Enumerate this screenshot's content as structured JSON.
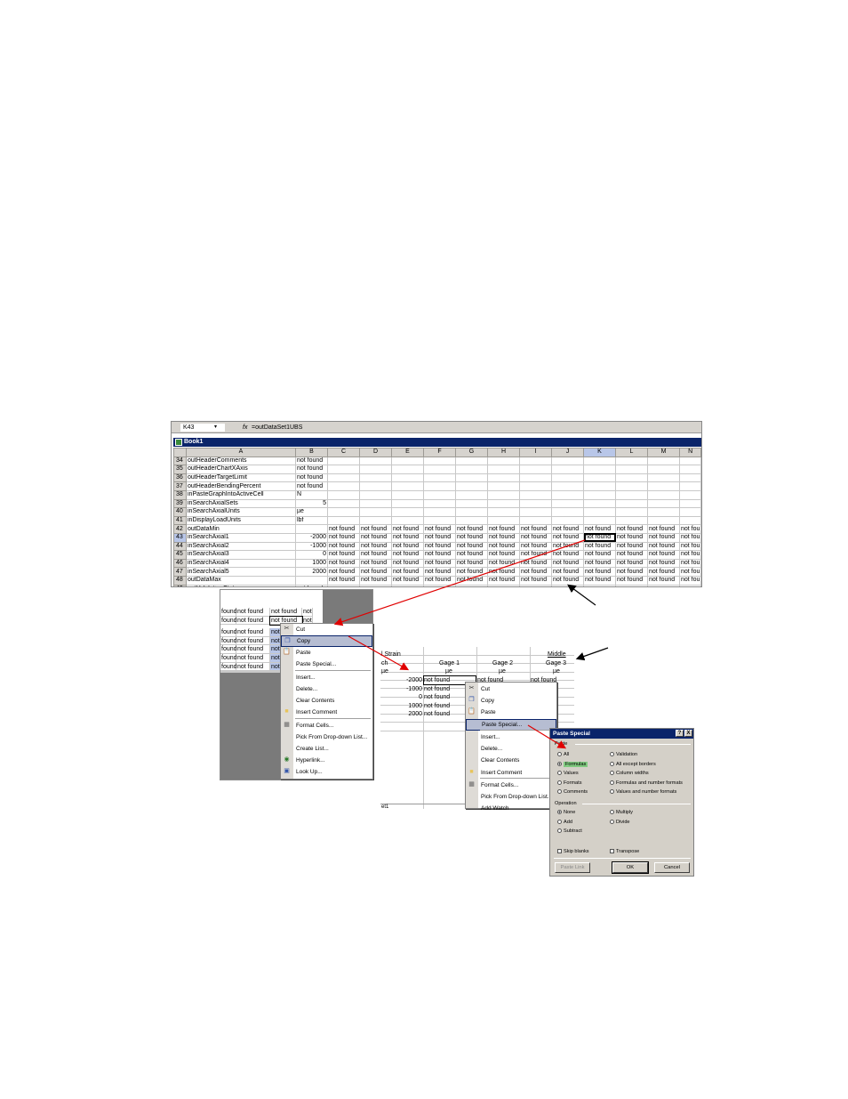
{
  "formula_bar": {
    "name_box": "K43",
    "fx": "fx",
    "formula": "=outDataSet1UBS"
  },
  "workbook_title": "Book1",
  "sheet": {
    "columns": [
      "A",
      "B",
      "C",
      "D",
      "E",
      "F",
      "G",
      "H",
      "I",
      "J",
      "K",
      "L",
      "M",
      "N"
    ],
    "rows": [
      {
        "num": "34",
        "a": "outHeaderComments",
        "b": "not found",
        "rest": []
      },
      {
        "num": "35",
        "a": "outHeaderChartXAxis",
        "b": "not found",
        "rest": []
      },
      {
        "num": "36",
        "a": "outHeaderTargetLimit",
        "b": "not found",
        "rest": []
      },
      {
        "num": "37",
        "a": "outHeaderBendingPercent",
        "b": "not found",
        "rest": []
      },
      {
        "num": "38",
        "a": "inPasteGraphIntoActiveCell",
        "b": "N",
        "rest": []
      },
      {
        "num": "39",
        "a": "inSearchAxialSets",
        "b": "5",
        "rest": []
      },
      {
        "num": "40",
        "a": "inSearchAxialUnits",
        "b": "µe",
        "rest": []
      },
      {
        "num": "41",
        "a": "inDisplayLoadUnits",
        "b": "lbf",
        "rest": []
      },
      {
        "num": "42",
        "a": "outDataMin",
        "b": "",
        "rest": [
          "not found",
          "not found",
          "not found",
          "not found",
          "not found",
          "not found",
          "not found",
          "not found",
          "not found",
          "not found",
          "not found",
          "not fou"
        ]
      },
      {
        "num": "43",
        "a": "inSearchAxial1",
        "b": "-2000",
        "rest": [
          "not found",
          "not found",
          "not found",
          "not found",
          "not found",
          "not found",
          "not found",
          "not found",
          "not found",
          "not found",
          "not found",
          "not fou"
        ]
      },
      {
        "num": "44",
        "a": "inSearchAxial2",
        "b": "-1000",
        "rest": [
          "not found",
          "not found",
          "not found",
          "not found",
          "not found",
          "not found",
          "not found",
          "not found",
          "not found",
          "not found",
          "not found",
          "not fou"
        ]
      },
      {
        "num": "45",
        "a": "inSearchAxial3",
        "b": "0",
        "rest": [
          "not found",
          "not found",
          "not found",
          "not found",
          "not found",
          "not found",
          "not found",
          "not found",
          "not found",
          "not found",
          "not found",
          "not fou"
        ]
      },
      {
        "num": "46",
        "a": "inSearchAxial4",
        "b": "1000",
        "rest": [
          "not found",
          "not found",
          "not found",
          "not found",
          "not found",
          "not found",
          "not found",
          "not found",
          "not found",
          "not found",
          "not found",
          "not fou"
        ]
      },
      {
        "num": "47",
        "a": "inSearchAxial5",
        "b": "2000",
        "rest": [
          "not found",
          "not found",
          "not found",
          "not found",
          "not found",
          "not found",
          "not found",
          "not found",
          "not found",
          "not found",
          "not found",
          "not fou"
        ]
      },
      {
        "num": "48",
        "a": "outDataMax",
        "b": "",
        "rest": [
          "not found",
          "not found",
          "not found",
          "not found",
          "not found",
          "not found",
          "not found",
          "not found",
          "not found",
          "not found",
          "not found",
          "not fou"
        ]
      },
      {
        "num": "49",
        "a": "outValidationStatus",
        "b": "not found",
        "rest": []
      }
    ]
  },
  "left_snippet": {
    "rows": [
      [
        "found",
        "not found",
        "not found",
        "not"
      ],
      [
        "found",
        "not found",
        "not found",
        "not"
      ],
      [
        "found",
        "not found",
        "not",
        ""
      ],
      [
        "found",
        "not found",
        "not",
        ""
      ],
      [
        "found",
        "not found",
        "not",
        ""
      ],
      [
        "found",
        "not found",
        "not",
        ""
      ],
      [
        "found",
        "not found",
        "not",
        ""
      ]
    ],
    "menu": [
      "Cut",
      "Copy",
      "Paste",
      "Paste Special...",
      "Insert...",
      "Delete...",
      "Clear Contents",
      "Insert Comment",
      "Format Cells...",
      "Pick From Drop-down List...",
      "Create List...",
      "Hyperlink...",
      "Look Up..."
    ]
  },
  "middle_snippet": {
    "header1_left": "l Strain",
    "header1_right": "Middle",
    "col_label": "ch",
    "gages": [
      "Gage 1",
      "Gage 2",
      "Gage 3"
    ],
    "units_row": [
      "µe",
      "µe",
      "µe",
      "µe"
    ],
    "values": [
      "-2000",
      "-1000",
      "0",
      "1000",
      "2000"
    ],
    "cells": [
      [
        "not found",
        "not found",
        "not found"
      ],
      [
        "not found",
        "",
        ""
      ],
      [
        "not found",
        "",
        ""
      ],
      [
        "not found",
        "",
        ""
      ],
      [
        "not found",
        "",
        ""
      ]
    ],
    "footer": "et1",
    "menu": [
      "Cut",
      "Copy",
      "Paste",
      "Paste Special...",
      "Insert...",
      "Delete...",
      "Clear Contents",
      "Insert Comment",
      "Format Cells...",
      "Pick From Drop-down List...",
      "Add Watch"
    ]
  },
  "paste_special": {
    "title": "Paste Special",
    "help_btn": "?",
    "close_btn": "X",
    "paste_label": "Paste",
    "paste_left": [
      "All",
      "Formulas",
      "Values",
      "Formats",
      "Comments"
    ],
    "paste_right": [
      "Validation",
      "All except borders",
      "Column widths",
      "Formulas and number formats",
      "Values and number formats"
    ],
    "operation_label": "Operation",
    "op_left": [
      "None",
      "Add",
      "Subtract"
    ],
    "op_right": [
      "Multiply",
      "Divide"
    ],
    "skip_blanks": "Skip blanks",
    "transpose": "Transpose",
    "paste_link": "Paste Link",
    "ok": "OK",
    "cancel": "Cancel"
  },
  "colors": {
    "title_bar": "#0a246a",
    "arrow_red": "#e00000",
    "highlight_green": "#7fc97f"
  }
}
